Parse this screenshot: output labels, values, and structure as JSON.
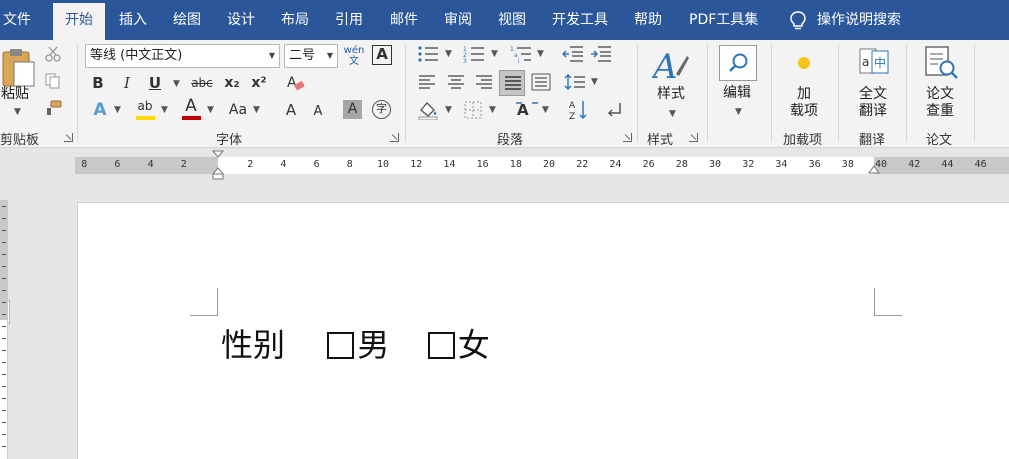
{
  "menu": {
    "tabs": [
      {
        "label": "文件",
        "active": false
      },
      {
        "label": "开始",
        "active": true
      },
      {
        "label": "插入",
        "active": false
      },
      {
        "label": "绘图",
        "active": false
      },
      {
        "label": "设计",
        "active": false
      },
      {
        "label": "布局",
        "active": false
      },
      {
        "label": "引用",
        "active": false
      },
      {
        "label": "邮件",
        "active": false
      },
      {
        "label": "审阅",
        "active": false
      },
      {
        "label": "视图",
        "active": false
      },
      {
        "label": "开发工具",
        "active": false
      },
      {
        "label": "帮助",
        "active": false
      },
      {
        "label": "PDF工具集",
        "active": false
      }
    ],
    "tell_me": "操作说明搜索"
  },
  "ribbon": {
    "clipboard": {
      "paste_label": "粘贴",
      "group_label": "剪贴板"
    },
    "font": {
      "font_name": "等线 (中文正文)",
      "font_size": "二号",
      "phonetic_glyph": "wén 文",
      "char_border_glyph": "A",
      "bold": "B",
      "italic": "I",
      "underline": "U",
      "strike": "abc",
      "sub": "x₂",
      "sup": "x²",
      "text_effects": "A",
      "highlight": "ab",
      "font_color": "A",
      "change_case": "Aa",
      "grow": "A",
      "shrink": "A",
      "char_shading": "A",
      "enclose": "字",
      "group_label": "字体"
    },
    "paragraph": {
      "group_label": "段落"
    },
    "styles": {
      "label": "样式",
      "group_label": "样式"
    },
    "editing": {
      "label": "编辑"
    },
    "addins": {
      "line1": "加",
      "line2": "载项",
      "group_label": "加载项"
    },
    "translate": {
      "line1": "全文",
      "line2": "翻译",
      "group_label": "翻译"
    },
    "paper": {
      "line1": "论文",
      "line2": "查重",
      "group_label": "论文"
    }
  },
  "ruler": {
    "left_numbers": [
      "8",
      "6",
      "4",
      "2"
    ],
    "right_numbers": [
      "2",
      "4",
      "6",
      "8",
      "10",
      "12",
      "14",
      "16",
      "18",
      "20",
      "22",
      "24",
      "26",
      "28",
      "30",
      "32",
      "34",
      "36",
      "38",
      "40",
      "42",
      "44",
      "46"
    ]
  },
  "document": {
    "label": "性别",
    "option1": "男",
    "option2": "女"
  },
  "colors": {
    "title_bar": "#2b579a",
    "ribbon_bg": "#f3f3f3",
    "font_color_bar": "#c00000",
    "highlight_bar": "#ffd800",
    "addin_dot": "#f5c518"
  }
}
